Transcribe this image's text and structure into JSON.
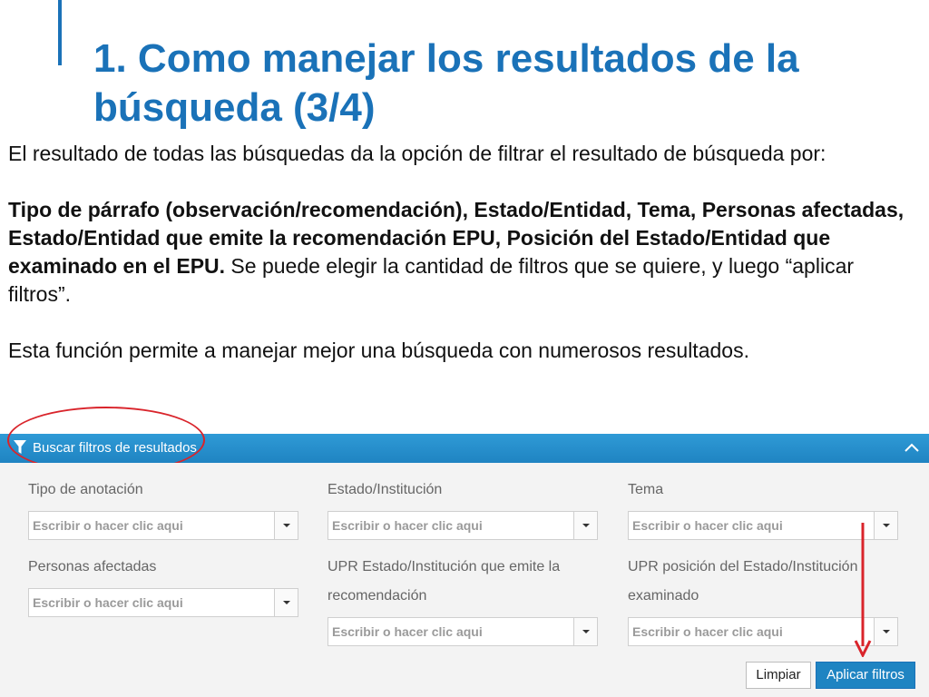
{
  "slide": {
    "title": "1. Como manejar los resultados de la búsqueda (3/4)",
    "intro": "El resultado de todas las búsquedas da la opción de filtrar el resultado de búsqueda por:",
    "filters_bold": "Tipo de párrafo (observación/recomendación), Estado/Entidad, Tema, Personas afectadas, Estado/Entidad que emite la recomendación EPU, Posición del Estado/Entidad que examinado en el EPU.",
    "filters_rest": " Se puede elegir la cantidad de filtros que se quiere, y luego “aplicar filtros”.",
    "closing": "Esta función permite a manejar mejor una búsqueda con numerosos resultados.",
    "accent_color": "#1a72b8"
  },
  "panel": {
    "header_label": "Buscar filtros de resultados",
    "header_icon": "filter-icon",
    "collapse_icon": "chevron-up-icon",
    "header_color": "#2f9ad6",
    "fields": {
      "tipo": {
        "label": "Tipo de anotación",
        "placeholder": "Escribir o hacer clic aqui"
      },
      "estado": {
        "label": "Estado/Institución",
        "placeholder": "Escribir o hacer clic aqui"
      },
      "tema": {
        "label": "Tema",
        "placeholder": "Escribir o hacer clic aqui"
      },
      "personas": {
        "label": "Personas afectadas",
        "placeholder": "Escribir o hacer clic aqui"
      },
      "upr_emite": {
        "label_line1": "UPR Estado/Institución que emite la",
        "label_line2": "recomendación",
        "placeholder": "Escribir o hacer clic aqui"
      },
      "upr_posicion": {
        "label_line1": "UPR posición del Estado/Institución",
        "label_line2": "examinado",
        "placeholder": "Escribir o hacer clic aqui"
      }
    },
    "buttons": {
      "clear": "Limpiar",
      "apply": "Aplicar filtros"
    }
  },
  "annotations": {
    "highlight_color": "#d9242b",
    "arrow_color": "#d9242b"
  }
}
